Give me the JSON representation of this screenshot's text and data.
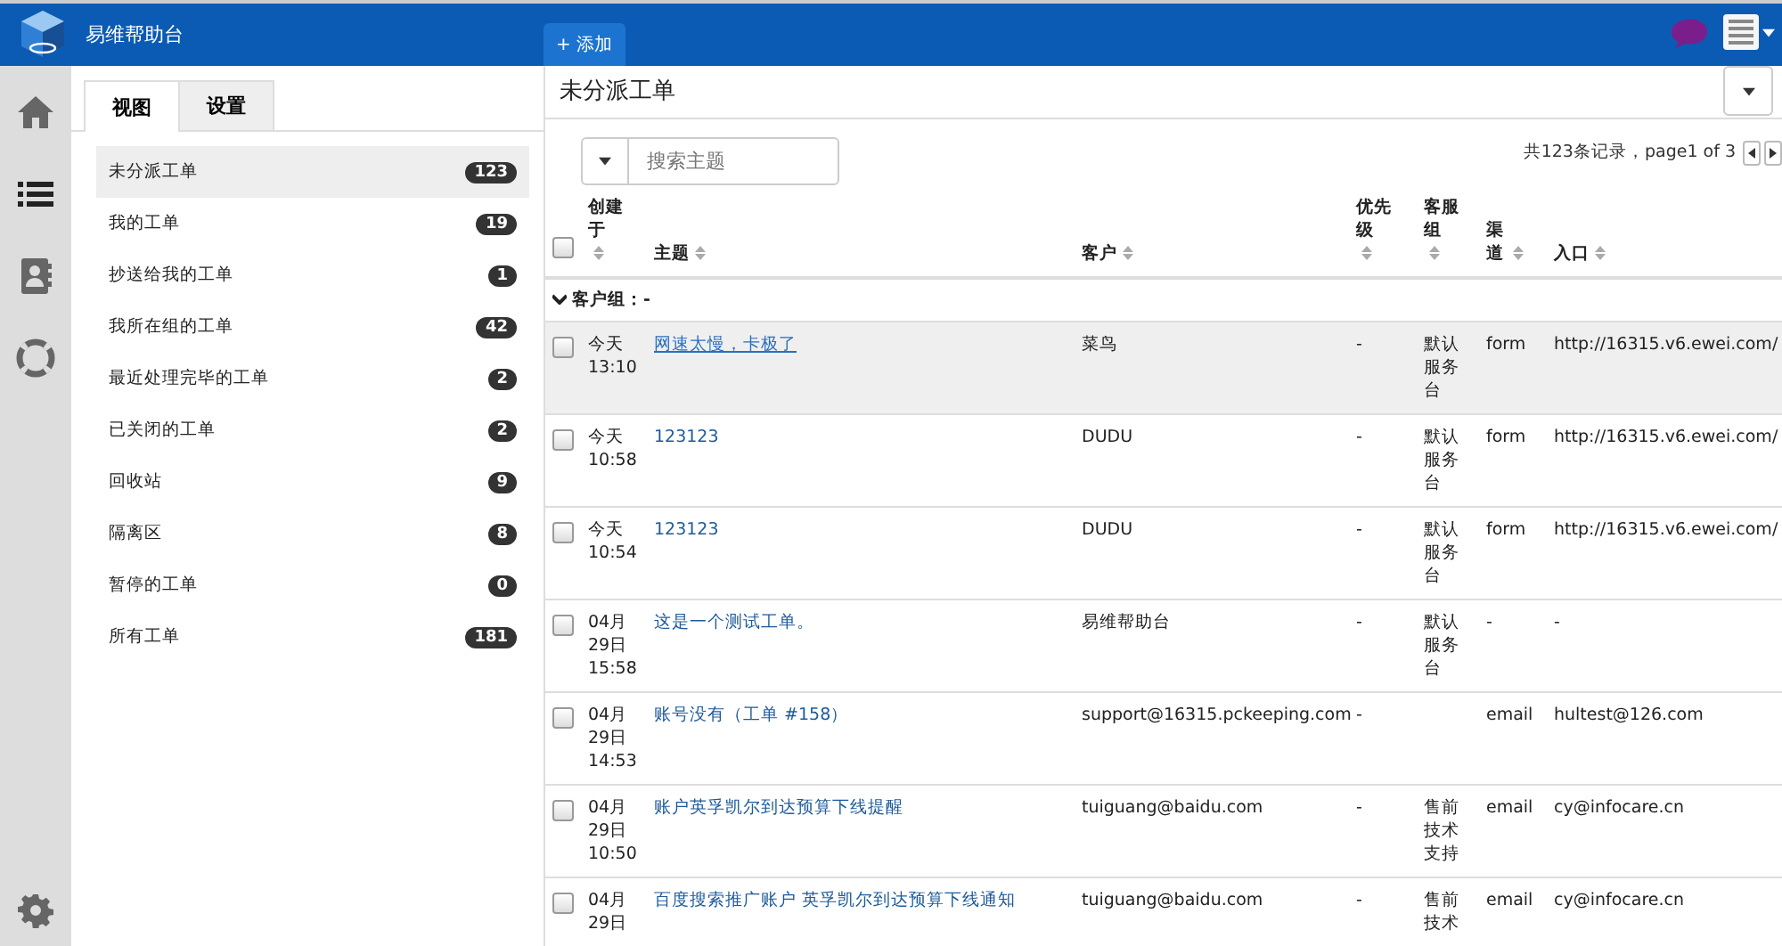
{
  "header": {
    "app_title": "易维帮助台",
    "add_tab": {
      "icon": "+",
      "label": "添加"
    }
  },
  "rail": [
    {
      "kind": "home"
    },
    {
      "kind": "list"
    },
    {
      "kind": "contacts"
    },
    {
      "kind": "help"
    }
  ],
  "sidebar": {
    "tabs": [
      {
        "label": "视图",
        "selected": true
      },
      {
        "label": "设置",
        "selected": false
      }
    ],
    "items": [
      {
        "label": "未分派工单",
        "count": "123",
        "selected": true
      },
      {
        "label": "我的工单",
        "count": "19",
        "selected": false
      },
      {
        "label": "抄送给我的工单",
        "count": "1",
        "selected": false
      },
      {
        "label": "我所在组的工单",
        "count": "42",
        "selected": false
      },
      {
        "label": "最近处理完毕的工单",
        "count": "2",
        "selected": false
      },
      {
        "label": "已关闭的工单",
        "count": "2",
        "selected": false
      },
      {
        "label": "回收站",
        "count": "9",
        "selected": false
      },
      {
        "label": "隔离区",
        "count": "8",
        "selected": false
      },
      {
        "label": "暂停的工单",
        "count": "0",
        "selected": false
      },
      {
        "label": "所有工单",
        "count": "181",
        "selected": false
      }
    ]
  },
  "main": {
    "title": "未分派工单",
    "search": {
      "placeholder": "搜索主题"
    },
    "pagination": "共123条记录，page1 of 3",
    "table": {
      "all_checked": false,
      "columns": [
        "创建于",
        "主题",
        "客户",
        "优先级",
        "客服组",
        "渠道",
        "入口"
      ],
      "group_label": "客户组：-",
      "rows": [
        {
          "selected": true,
          "checked": false,
          "created": "今天 13:10",
          "subject": "网速太慢，卡极了",
          "customer": "菜鸟",
          "priority": "-",
          "group": "默认服务台",
          "channel": "form",
          "entry": "http://16315.v6.ewei.com/"
        },
        {
          "selected": false,
          "checked": false,
          "created": "今天 10:58",
          "subject": "123123",
          "customer": "DUDU",
          "priority": "-",
          "group": "默认服务台",
          "channel": "form",
          "entry": "http://16315.v6.ewei.com/"
        },
        {
          "selected": false,
          "checked": false,
          "created": "今天 10:54",
          "subject": "123123",
          "customer": "DUDU",
          "priority": "-",
          "group": "默认服务台",
          "channel": "form",
          "entry": "http://16315.v6.ewei.com/"
        },
        {
          "selected": false,
          "checked": false,
          "created": "04月29日 15:58",
          "subject": "这是一个测试工单。",
          "customer": "易维帮助台",
          "priority": "-",
          "group": "默认服务台",
          "channel": "-",
          "entry": "-"
        },
        {
          "selected": false,
          "checked": false,
          "created": "04月29日 14:53",
          "subject": "账号没有（工单 #158）",
          "customer": "support@16315.pckeeping.com",
          "priority": "-",
          "group": "",
          "channel": "email",
          "entry": "hultest@126.com"
        },
        {
          "selected": false,
          "checked": false,
          "created": "04月29日 10:50",
          "subject": "账户英孚凯尔到达预算下线提醒",
          "customer": "tuiguang@baidu.com",
          "priority": "-",
          "group": "售前技术支持",
          "channel": "email",
          "entry": "cy@infocare.cn"
        },
        {
          "selected": false,
          "checked": false,
          "created": "04月29日",
          "subject": "百度搜索推广账户 英孚凯尔到达预算下线通知",
          "customer": "tuiguang@baidu.com",
          "priority": "-",
          "group": "售前技术",
          "channel": "email",
          "entry": "cy@infocare.cn"
        }
      ]
    }
  }
}
